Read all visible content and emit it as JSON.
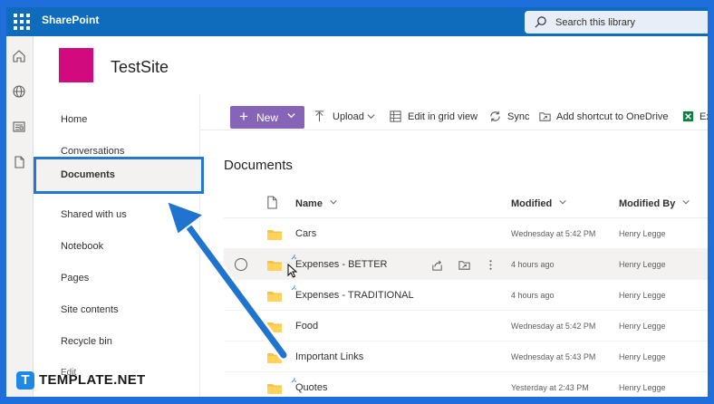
{
  "topbar": {
    "app_name": "SharePoint",
    "search_placeholder": "Search this library"
  },
  "site": {
    "title": "TestSite",
    "logo_color": "#d10b7d"
  },
  "leftnav": {
    "items": [
      {
        "label": "Home"
      },
      {
        "label": "Conversations"
      },
      {
        "label": "Documents",
        "selected": true
      },
      {
        "label": "Shared with us"
      },
      {
        "label": "Notebook"
      },
      {
        "label": "Pages"
      },
      {
        "label": "Site contents"
      },
      {
        "label": "Recycle bin"
      },
      {
        "label": "Edit"
      }
    ]
  },
  "commandbar": {
    "new_label": "New",
    "upload_label": "Upload",
    "grid_label": "Edit in grid view",
    "sync_label": "Sync",
    "shortcut_label": "Add shortcut to OneDrive",
    "export_label": "Exp"
  },
  "library": {
    "title": "Documents",
    "columns": {
      "name": "Name",
      "modified": "Modified",
      "modified_by": "Modified By"
    },
    "rows": [
      {
        "name": "Cars",
        "modified": "Wednesday at 5:42 PM",
        "modified_by": "Henry Legge"
      },
      {
        "name": "Expenses - BETTER",
        "modified": "4 hours ago",
        "modified_by": "Henry Legge"
      },
      {
        "name": "Expenses - TRADITIONAL",
        "modified": "4 hours ago",
        "modified_by": "Henry Legge"
      },
      {
        "name": "Food",
        "modified": "Wednesday at 5:42 PM",
        "modified_by": "Henry Legge"
      },
      {
        "name": "Important Links",
        "modified": "Wednesday at 5:43 PM",
        "modified_by": "Henry Legge"
      },
      {
        "name": "Quotes",
        "modified": "Yesterday at 2:43 PM",
        "modified_by": "Henry Legge"
      }
    ]
  },
  "watermark": {
    "badge": "T",
    "text": "TEMPLATE.NET"
  },
  "colors": {
    "suite_bar": "#0f6cbd",
    "accent": "#8764b8",
    "highlight": "#2577d1",
    "folder": "#f6c342"
  }
}
